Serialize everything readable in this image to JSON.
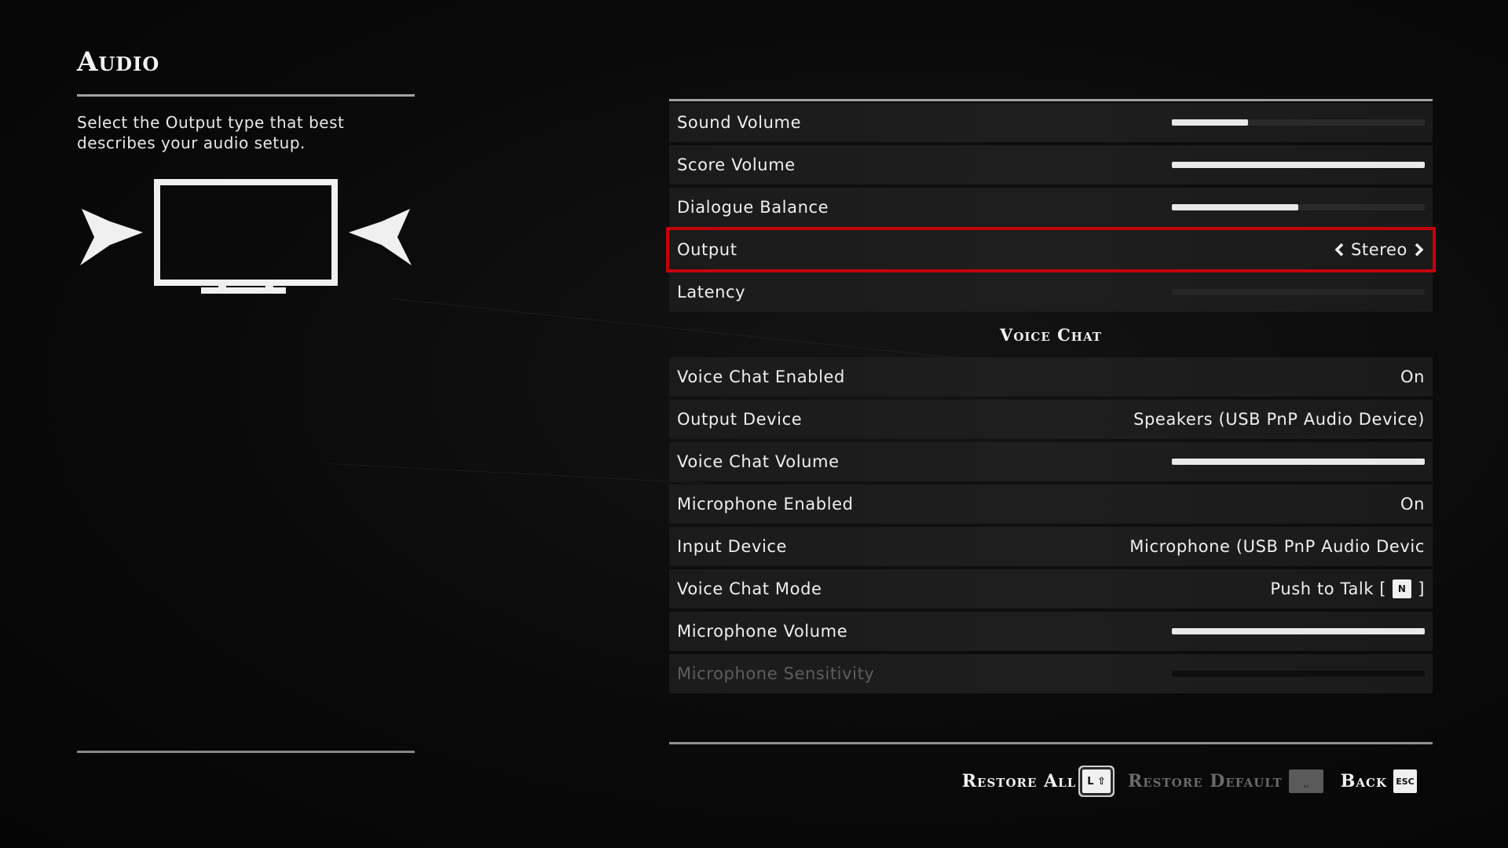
{
  "page": {
    "title": "Audio"
  },
  "description": "Select the Output type that best describes your audio setup.",
  "illustration": {
    "name": "tv-stereo-speakers"
  },
  "settings": [
    {
      "label": "Sound Volume",
      "type": "slider",
      "level": 0.3
    },
    {
      "label": "Score Volume",
      "type": "slider",
      "level": 1.0
    },
    {
      "label": "Dialogue Balance",
      "type": "slider",
      "level": 0.5
    },
    {
      "label": "Output",
      "type": "selector",
      "value": "Stereo",
      "selected": true
    },
    {
      "label": "Latency",
      "type": "slider",
      "level": 0.0
    }
  ],
  "voice_chat": {
    "heading": "Voice Chat",
    "rows": [
      {
        "label": "Voice Chat Enabled",
        "value": "On"
      },
      {
        "label": "Output Device",
        "value": "Speakers (USB PnP Audio Device)"
      },
      {
        "label": "Voice Chat Volume",
        "level": 1.0
      },
      {
        "label": "Microphone Enabled",
        "value": "On"
      },
      {
        "label": "Input Device",
        "value": "Microphone (USB PnP Audio Devic"
      },
      {
        "label": "Voice Chat Mode",
        "value": "Push to Talk [",
        "key": "N",
        "suffix": "]"
      },
      {
        "label": "Microphone Volume",
        "level": 1.0
      },
      {
        "label": "Microphone Sensitivity",
        "level": 0.0,
        "disabled": true
      }
    ]
  },
  "footer": {
    "restore_all": {
      "label": "Restore All",
      "key": "L ⇧"
    },
    "restore_default": {
      "label": "Restore Default",
      "key": "⎵"
    },
    "back": {
      "label": "Back",
      "key": "ESC"
    }
  },
  "colors": {
    "selection": "#c4000c",
    "background": "#070707",
    "row": "#1c1c1c",
    "text": "#efefef"
  }
}
